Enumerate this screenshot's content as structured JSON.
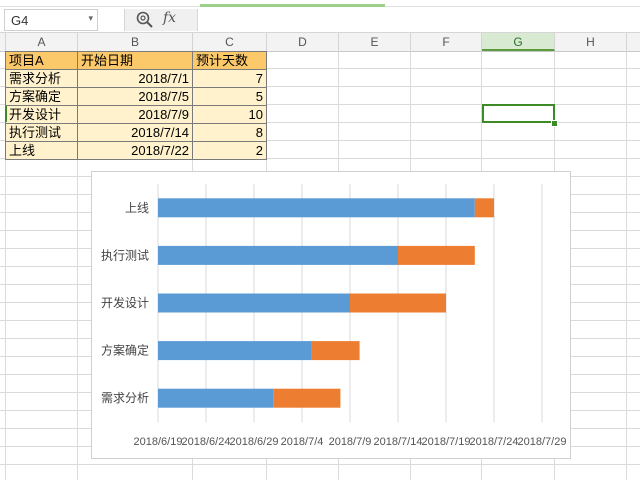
{
  "formula_bar": {
    "name_box": "G4",
    "name_box_arrow": "▾",
    "zoom_icon": "zoom-icon",
    "fx_label": "fx",
    "formula_value": ""
  },
  "columns": [
    "A",
    "B",
    "C",
    "D",
    "E",
    "F",
    "G",
    "H"
  ],
  "selected_column": "G",
  "table": {
    "headers": [
      "项目A",
      "开始日期",
      "预计天数"
    ],
    "rows": [
      [
        "需求分析",
        "2018/7/1",
        "7"
      ],
      [
        "方案确定",
        "2018/7/5",
        "5"
      ],
      [
        "开发设计",
        "2018/7/9",
        "10"
      ],
      [
        "执行测试",
        "2018/7/14",
        "8"
      ],
      [
        "上线",
        "2018/7/22",
        "2"
      ]
    ]
  },
  "colors": {
    "header_fill": "#fbc86a",
    "row_fill": "#fff2cc",
    "start_bar": "#5b9bd5",
    "duration_bar": "#ed7d31",
    "selection": "#3d8b27"
  },
  "chart_data": {
    "type": "bar",
    "orientation": "horizontal",
    "stacked": true,
    "categories": [
      "需求分析",
      "方案确定",
      "开发设计",
      "执行测试",
      "上线"
    ],
    "series": [
      {
        "values": [
          "2018/7/1",
          "2018/7/5",
          "2018/7/9",
          "2018/7/14",
          "2018/7/22"
        ]
      },
      {
        "values": [
          7,
          5,
          10,
          8,
          2
        ]
      }
    ],
    "xlim": [
      "2018/6/19",
      "2018/7/29"
    ],
    "x_ticks": [
      "2018/6/19",
      "2018/6/24",
      "2018/6/29",
      "2018/7/4",
      "2018/7/9",
      "2018/7/14",
      "2018/7/19",
      "2018/7/24",
      "2018/7/29"
    ],
    "grid": "vertical",
    "legend": "none"
  }
}
